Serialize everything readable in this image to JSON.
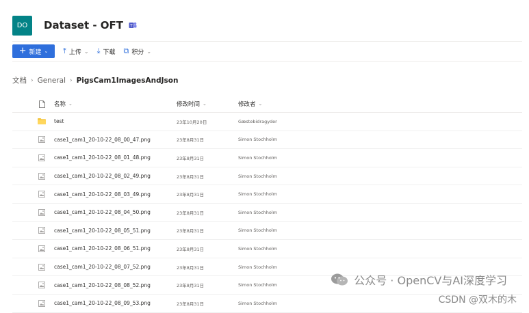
{
  "site": {
    "logo_text": "DO",
    "title": "Dataset - OFT",
    "teams_icon": "teams-icon",
    "logo_color": "#038387"
  },
  "toolbar": {
    "new_label": "新建",
    "upload_label": "上传",
    "download_label": "下载",
    "integrate_label": "积分",
    "accent_color": "#2f6fdc"
  },
  "breadcrumb": {
    "root": "文档",
    "level1": "General",
    "current": "PigsCam1ImagesAndJson"
  },
  "table": {
    "headers": {
      "name": "名称",
      "modified": "修改时间",
      "modified_by": "修改者"
    },
    "rows": [
      {
        "type": "folder",
        "name": "test",
        "modified": "23年10月20日",
        "modified_by": "Gæstebidragyder"
      },
      {
        "type": "image",
        "name": "case1_cam1_20-10-22_08_00_47.png",
        "modified": "23年8月31日",
        "modified_by": "Simon Stochholm"
      },
      {
        "type": "image",
        "name": "case1_cam1_20-10-22_08_01_48.png",
        "modified": "23年8月31日",
        "modified_by": "Simon Stochholm"
      },
      {
        "type": "image",
        "name": "case1_cam1_20-10-22_08_02_49.png",
        "modified": "23年8月31日",
        "modified_by": "Simon Stochholm"
      },
      {
        "type": "image",
        "name": "case1_cam1_20-10-22_08_03_49.png",
        "modified": "23年8月31日",
        "modified_by": "Simon Stochholm"
      },
      {
        "type": "image",
        "name": "case1_cam1_20-10-22_08_04_50.png",
        "modified": "23年8月31日",
        "modified_by": "Simon Stochholm"
      },
      {
        "type": "image",
        "name": "case1_cam1_20-10-22_08_05_51.png",
        "modified": "23年8月31日",
        "modified_by": "Simon Stochholm"
      },
      {
        "type": "image",
        "name": "case1_cam1_20-10-22_08_06_51.png",
        "modified": "23年8月31日",
        "modified_by": "Simon Stochholm"
      },
      {
        "type": "image",
        "name": "case1_cam1_20-10-22_08_07_52.png",
        "modified": "23年8月31日",
        "modified_by": "Simon Stochholm"
      },
      {
        "type": "image",
        "name": "case1_cam1_20-10-22_08_08_52.png",
        "modified": "23年8月31日",
        "modified_by": "Simon Stochholm"
      },
      {
        "type": "image",
        "name": "case1_cam1_20-10-22_08_09_53.png",
        "modified": "23年8月31日",
        "modified_by": "Simon Stochholm"
      }
    ]
  },
  "watermark": {
    "text": "公众号 · OpenCV与AI深度学习",
    "csdn": "CSDN @双木的木"
  }
}
